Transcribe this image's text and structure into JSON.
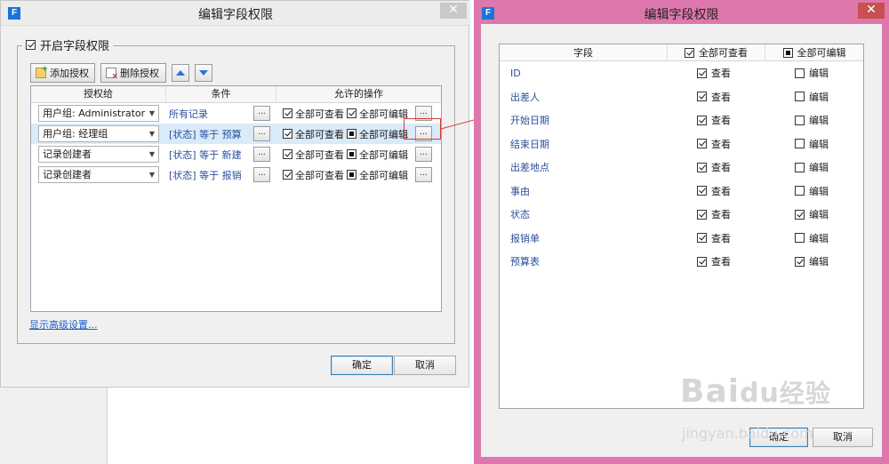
{
  "left_dialog": {
    "title": "编辑字段权限",
    "close": "✕",
    "enable_label": "开启字段权限",
    "toolbar": {
      "add": "添加授权",
      "delete": "删除授权"
    },
    "columns": [
      "授权给",
      "条件",
      "允许的操作"
    ],
    "rows": [
      {
        "grantee": "用户组: Administrator",
        "condition": "所有记录",
        "view": "全部可查看",
        "edit": "全部可编辑",
        "edit_state": "checked"
      },
      {
        "grantee": "用户组: 经理组",
        "condition": "[状态] 等于 预算",
        "view": "全部可查看",
        "edit": "全部可编辑",
        "edit_state": "partial"
      },
      {
        "grantee": "记录创建者",
        "condition": "[状态] 等于 新建",
        "view": "全部可查看",
        "edit": "全部可编辑",
        "edit_state": "partial"
      },
      {
        "grantee": "记录创建者",
        "condition": "[状态] 等于 报销",
        "view": "全部可查看",
        "edit": "全部可编辑",
        "edit_state": "partial"
      }
    ],
    "ellipsis": "...",
    "advanced_link": "显示高级设置...",
    "ok": "确定",
    "cancel": "取消"
  },
  "right_dialog": {
    "title": "编辑字段权限",
    "close": "✕",
    "columns": {
      "field": "字段",
      "view_all": "全部可查看",
      "edit_all": "全部可编辑"
    },
    "view_label": "查看",
    "edit_label": "编辑",
    "fields": [
      {
        "name": "ID",
        "view": true,
        "edit": false
      },
      {
        "name": "出差人",
        "view": true,
        "edit": false
      },
      {
        "name": "开始日期",
        "view": true,
        "edit": false
      },
      {
        "name": "结束日期",
        "view": true,
        "edit": false
      },
      {
        "name": "出差地点",
        "view": true,
        "edit": false
      },
      {
        "name": "事由",
        "view": true,
        "edit": false
      },
      {
        "name": "状态",
        "view": true,
        "edit": true
      },
      {
        "name": "报销单",
        "view": true,
        "edit": false
      },
      {
        "name": "预算表",
        "view": true,
        "edit": true
      }
    ],
    "ok": "确定",
    "cancel": "取消"
  },
  "watermark": {
    "brand": "Bai",
    "brand_suffix": "经验",
    "url": "jingyan.baidu.com"
  },
  "app_icon_letter": "F",
  "colors": {
    "accent": "#1b73d6",
    "pink_frame": "#de78ac",
    "close_red": "#c75050",
    "link": "#2060c8"
  }
}
